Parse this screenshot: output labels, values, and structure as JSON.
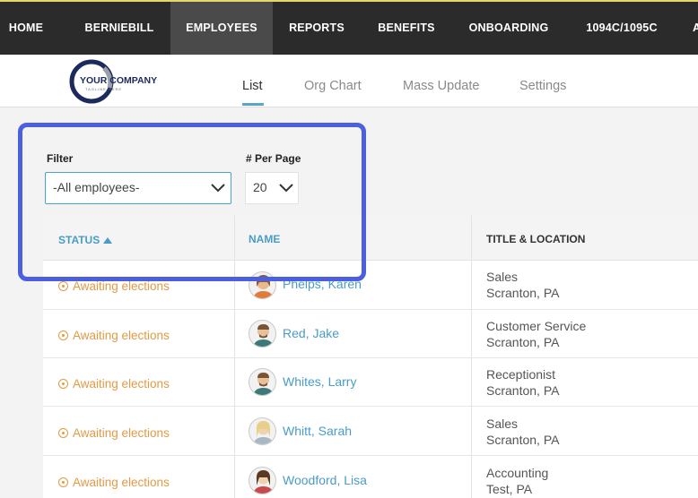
{
  "topnav": {
    "items": [
      "HOME",
      "BERNIEBILL",
      "EMPLOYEES",
      "REPORTS",
      "BENEFITS",
      "ONBOARDING",
      "1094C/1095C",
      "A"
    ],
    "active_index": 2
  },
  "logo": {
    "line1": "YOUR COMPANY",
    "line2": "TAGLINE HERE"
  },
  "subtabs": [
    "List",
    "Org Chart",
    "Mass Update",
    "Settings"
  ],
  "filter": {
    "label": "Filter",
    "value": "-All employees-"
  },
  "per_page": {
    "label": "# Per Page",
    "value": "20"
  },
  "table": {
    "headers": {
      "status": "STATUS",
      "name": "NAME",
      "title_location": "TITLE & LOCATION"
    },
    "sort_icon": "triangle-up-icon",
    "rows": [
      {
        "status": "Awaiting elections",
        "name": "Phelps, Karen",
        "title": "Sales",
        "location": "Scranton, PA",
        "avatar": "female-avatar-icon"
      },
      {
        "status": "Awaiting elections",
        "name": "Red, Jake",
        "title": "Customer Service",
        "location": "Scranton, PA",
        "avatar": "male-avatar-icon"
      },
      {
        "status": "Awaiting elections",
        "name": "Whites, Larry",
        "title": "Receptionist",
        "location": "Scranton, PA",
        "avatar": "male-avatar-icon"
      },
      {
        "status": "Awaiting elections",
        "name": "Whitt, Sarah",
        "title": "Sales",
        "location": "Scranton, PA",
        "avatar": "female-avatar-icon"
      },
      {
        "status": "Awaiting elections",
        "name": "Woodford, Lisa",
        "title": "Accounting",
        "location": "Test, PA",
        "avatar": "female-avatar-icon"
      }
    ]
  },
  "colors": {
    "accent": "#4aa3c8",
    "status": "#e39a45",
    "highlight": "#4b5fe0",
    "nav_bg": "#2b2b2b"
  }
}
